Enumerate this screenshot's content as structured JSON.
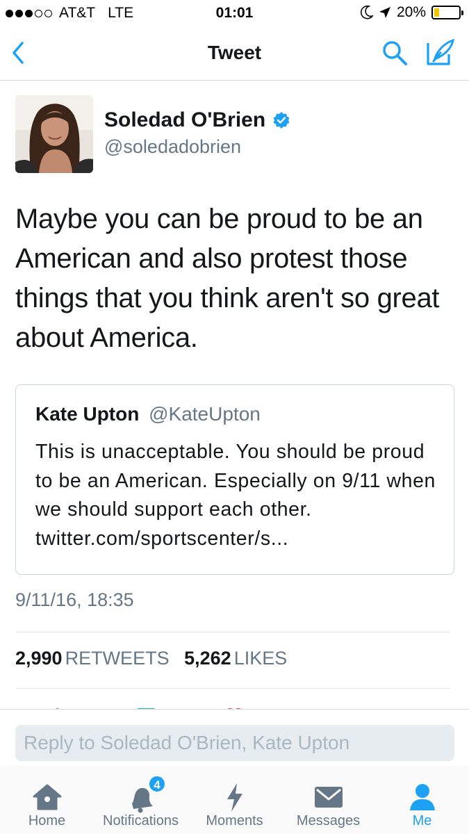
{
  "status_bar": {
    "carrier": "AT&T",
    "network": "LTE",
    "time": "01:01",
    "battery_percent": "20%",
    "battery_level": 0.2,
    "signal_bars": 3,
    "signal_total": 5
  },
  "nav": {
    "title": "Tweet",
    "back_icon": "chevron-left-icon",
    "search_icon": "search-icon",
    "compose_icon": "compose-icon"
  },
  "tweet": {
    "author_name": "Soledad O'Brien",
    "author_handle": "@soledadobrien",
    "verified": true,
    "text": "Maybe you can be proud to be an American and also protest those things that you think aren't so great about America.",
    "timestamp": "9/11/16, 18:35",
    "retweets_count": "2,990",
    "retweets_label": "RETWEETS",
    "likes_count": "5,262",
    "likes_label": "LIKES"
  },
  "quoted_tweet": {
    "author_name": "Kate Upton",
    "author_handle": "@KateUpton",
    "text": "This is unacceptable. You should be proud to be an American. Especially on 9/11 when we should support each other.  twitter.com/sportscenter/s..."
  },
  "reply": {
    "placeholder": "Reply to Soledad O'Brien, Kate Upton"
  },
  "tabs": [
    {
      "label": "Home",
      "icon": "home-icon",
      "active": false
    },
    {
      "label": "Notifications",
      "icon": "bell-icon",
      "active": false,
      "badge": "4"
    },
    {
      "label": "Moments",
      "icon": "lightning-icon",
      "active": false
    },
    {
      "label": "Messages",
      "icon": "envelope-icon",
      "active": false
    },
    {
      "label": "Me",
      "icon": "person-icon",
      "active": true
    }
  ],
  "colors": {
    "accent": "#1da1f2",
    "text": "#14171a",
    "secondary_text": "#657786",
    "like": "#e0245e",
    "retweet": "#19cf86",
    "battery_fill": "#f5c400"
  }
}
